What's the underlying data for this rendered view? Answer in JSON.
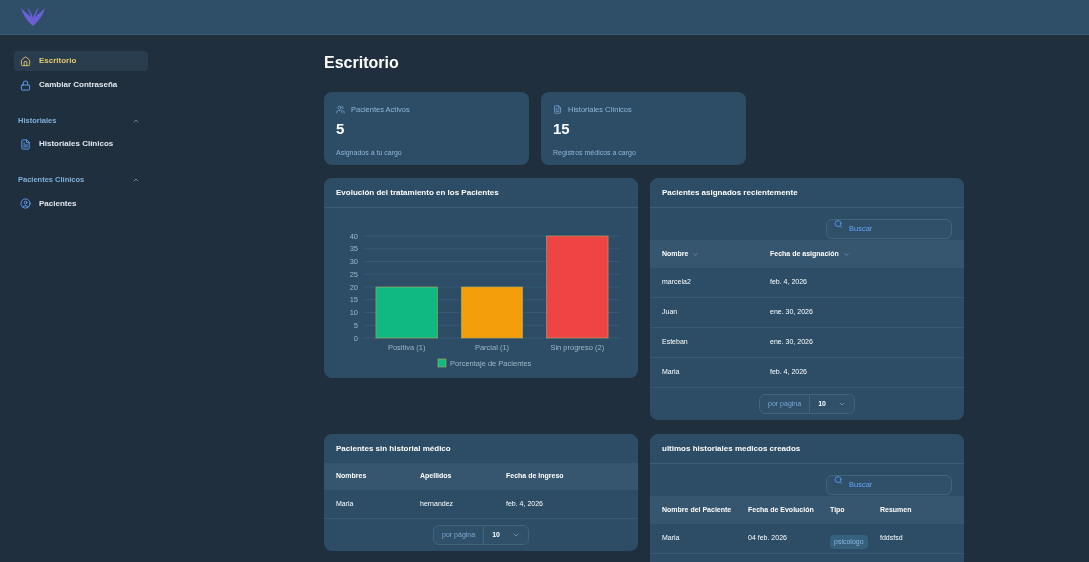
{
  "sidebar": {
    "items": [
      {
        "label": "Escritorio",
        "selected": true
      },
      {
        "label": "Cambiar Contraseña",
        "selected": false
      }
    ],
    "sections": [
      {
        "title": "Historiales",
        "expanded": true,
        "items": [
          {
            "label": "Historiales Clínicos",
            "selected": false
          }
        ]
      },
      {
        "title": "Pacientes Clínicos",
        "expanded": true,
        "items": [
          {
            "label": "Pacientes",
            "selected": false
          }
        ]
      }
    ]
  },
  "page_title": "Escritorio",
  "stats": [
    {
      "label": "Pacientes Activos",
      "value": "5",
      "caption": "Asignados a tu cargo"
    },
    {
      "label": "Historiales Clínicos",
      "value": "15",
      "caption": "Registros médicos a cargo"
    }
  ],
  "chart_card": {
    "title": "Evolución del tratamiento en los Pacientes",
    "chart_data": {
      "type": "bar",
      "categories": [
        "Positiva (1)",
        "Parcial (1)",
        "Sin progreso (2)"
      ],
      "series": [
        {
          "name": "Porcentaje de Pacientes",
          "color": "#10b981",
          "values": [
            20,
            null,
            null
          ]
        },
        {
          "color": "#f59e0b",
          "values": [
            null,
            20,
            null
          ]
        },
        {
          "color": "#ef4444",
          "values": [
            null,
            null,
            40
          ]
        }
      ],
      "stacked": true,
      "grid": true,
      "ylim": [
        0,
        40
      ],
      "yticks": [
        0,
        5,
        10,
        15,
        20,
        25,
        30,
        35,
        40
      ]
    }
  },
  "recent_patients": {
    "title": "Pacientes asignados recientemente",
    "search": {
      "placeholder": "Buscar"
    },
    "columns": [
      {
        "label": "Nombre",
        "sortable": true
      },
      {
        "label": "Fecha de asignación",
        "sortable": true
      }
    ],
    "rows": [
      [
        "marcela2",
        "feb. 4, 2026"
      ],
      [
        "Juan",
        "ene. 30, 2026"
      ],
      [
        "Esteban",
        "ene. 30, 2026"
      ],
      [
        "Maria",
        "feb. 4, 2026"
      ]
    ],
    "pager": {
      "label": "por página",
      "value": "10"
    }
  },
  "no_history": {
    "title": "Pacientes sin historial médico",
    "columns": [
      {
        "label": "Nombres"
      },
      {
        "label": "Apellidos"
      },
      {
        "label": "Fecha de Ingreso"
      }
    ],
    "rows": [
      [
        "Maria",
        "hernandez",
        "feb. 4, 2026"
      ]
    ],
    "pager": {
      "label": "por página",
      "value": "10"
    }
  },
  "latest_records": {
    "title": "ultimos historiales medicos creados",
    "search": {
      "placeholder": "Buscar"
    },
    "columns": [
      {
        "label": "Nombre del Paciente"
      },
      {
        "label": "Fecha de Evolución"
      },
      {
        "label": "Tipo"
      },
      {
        "label": "Resumen"
      }
    ],
    "rows": [
      {
        "name": "Maria",
        "date": "04 feb. 2026",
        "type": "psicologo",
        "summary": "fddsfsd"
      }
    ]
  }
}
